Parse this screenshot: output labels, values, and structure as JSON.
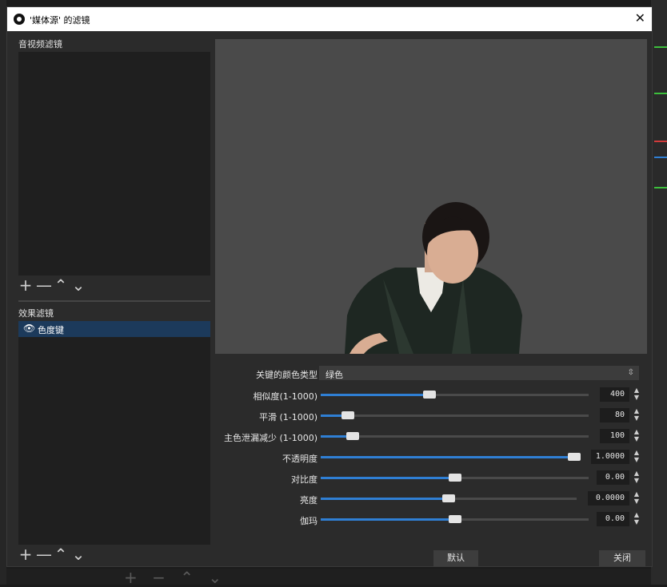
{
  "window": {
    "title": "'媒体源' 的滤镜",
    "close_label": "✕"
  },
  "av_filters": {
    "label": "音视频滤镜",
    "toolbar": [
      "+",
      "—",
      "⌃",
      "⌄"
    ]
  },
  "effect_filters": {
    "label": "效果滤镜",
    "toolbar": [
      "+",
      "—",
      "⌃",
      "⌄"
    ],
    "items": [
      {
        "name": "色度键",
        "icon": "eye-icon"
      }
    ]
  },
  "properties": {
    "key_color_type": {
      "label": "关键的颜色类型",
      "value": "绿色"
    },
    "sliders": [
      {
        "label": "相似度(1-1000)",
        "value": "400",
        "fraction": 0.4
      },
      {
        "label": "平滑 (1-1000)",
        "value": "80",
        "fraction": 0.08
      },
      {
        "label": "主色泄漏减少 (1-1000)",
        "value": "100",
        "fraction": 0.1
      },
      {
        "label": "不透明度",
        "value": "1.0000",
        "fraction": 1.0
      },
      {
        "label": "对比度",
        "value": "0.00",
        "fraction": 0.5
      },
      {
        "label": "亮度",
        "value": "0.0000",
        "fraction": 0.5
      },
      {
        "label": "伽玛",
        "value": "0.00",
        "fraction": 0.5
      }
    ]
  },
  "buttons": {
    "default": "默认",
    "close": "关闭"
  },
  "colors": {
    "accent": "#2f7fd4",
    "selection": "#1c3a5b",
    "panel": "#2b2b2b",
    "list": "#1f1f1f"
  }
}
